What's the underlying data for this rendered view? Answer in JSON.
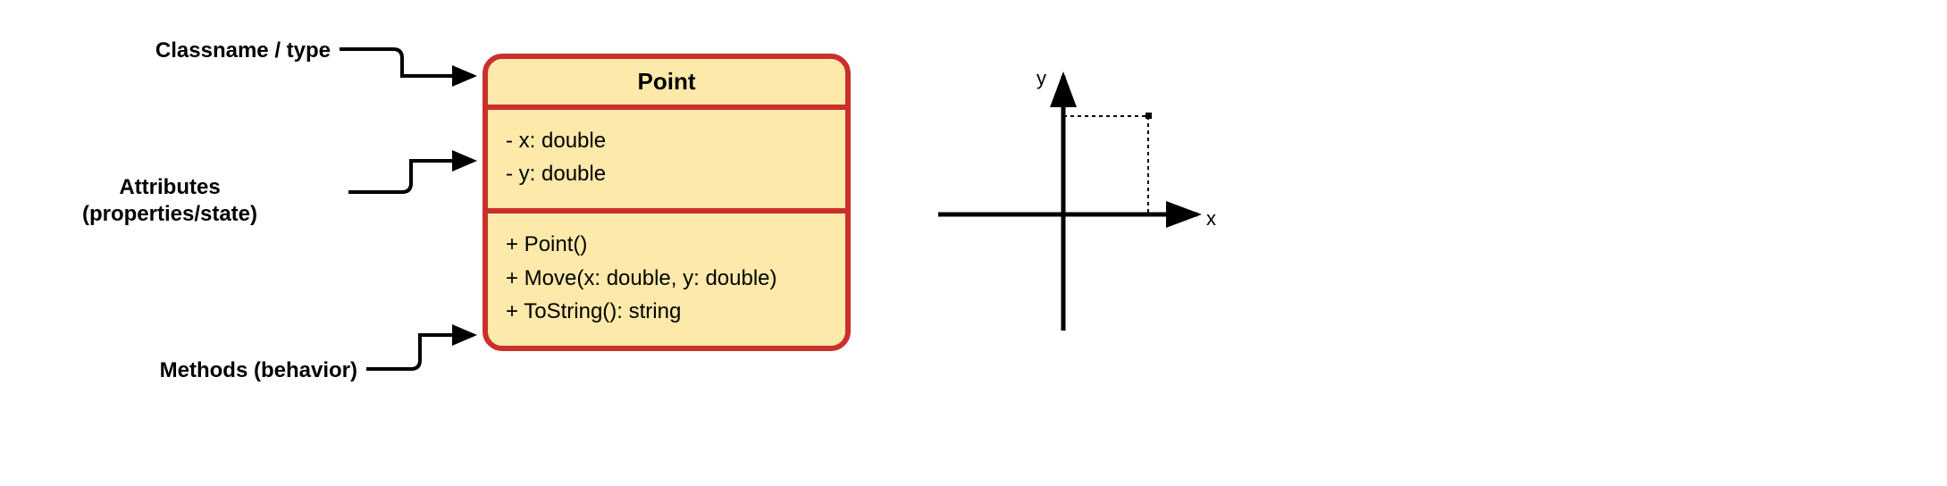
{
  "labels": {
    "classname": "Classname / type",
    "attributes": "Attributes\n(properties/state)",
    "methods": "Methods (behavior)"
  },
  "classBox": {
    "title": "Point",
    "attributes": [
      "- x: double",
      "- y: double"
    ],
    "methods": [
      "+ Point()",
      "+ Move(x: double, y: double)",
      "+ ToString(): string"
    ]
  },
  "axes": {
    "xLabel": "x",
    "yLabel": "y"
  }
}
